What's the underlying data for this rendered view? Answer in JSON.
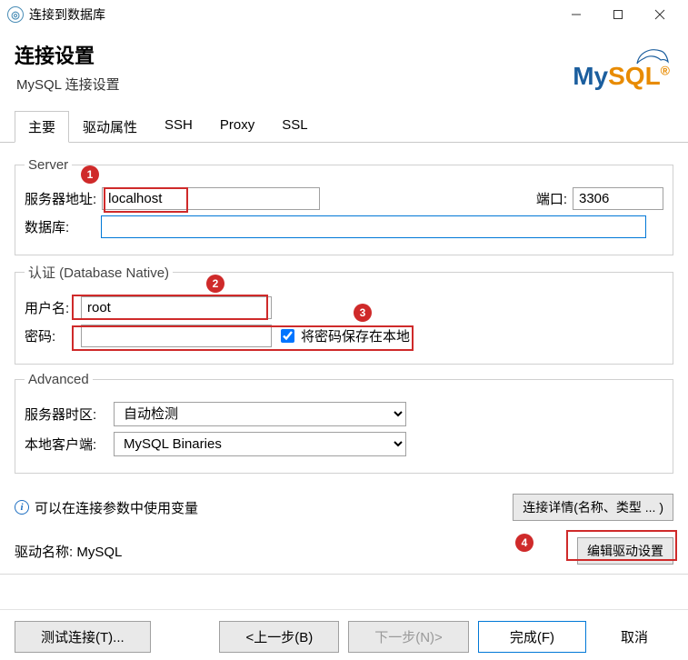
{
  "window": {
    "title": "连接到数据库",
    "minimize": "—",
    "maximize": "□",
    "close": "✕"
  },
  "header": {
    "title": "连接设置",
    "subtitle": "MySQL 连接设置",
    "logo_my": "My",
    "logo_sql": "SQL"
  },
  "tabs": [
    {
      "label": "主要",
      "active": true
    },
    {
      "label": "驱动属性",
      "active": false
    },
    {
      "label": "SSH",
      "active": false
    },
    {
      "label": "Proxy",
      "active": false
    },
    {
      "label": "SSL",
      "active": false
    }
  ],
  "groups": {
    "server": {
      "legend": "Server",
      "host_label": "服务器地址:",
      "host_value": "localhost",
      "port_label": "端口:",
      "port_value": "3306",
      "db_label": "数据库:",
      "db_value": ""
    },
    "auth": {
      "legend": "认证 (Database Native)",
      "user_label": "用户名:",
      "user_value": "root",
      "pass_label": "密码:",
      "pass_value": "",
      "save_pass_label": "将密码保存在本地"
    },
    "advanced": {
      "legend": "Advanced",
      "tz_label": "服务器时区:",
      "tz_value": "自动检测",
      "client_label": "本地客户端:",
      "client_value": "MySQL Binaries"
    }
  },
  "info": {
    "text": "可以在连接参数中使用变量",
    "details_btn": "连接详情(名称、类型 ... )"
  },
  "driver": {
    "label": "驱动名称:  MySQL",
    "edit_btn": "编辑驱动设置"
  },
  "footer": {
    "test": "测试连接(T)...",
    "back": "<上一步(B)",
    "next": "下一步(N)>",
    "finish": "完成(F)",
    "cancel": "取消"
  },
  "annotations": {
    "1": "1",
    "2": "2",
    "3": "3",
    "4": "4"
  }
}
